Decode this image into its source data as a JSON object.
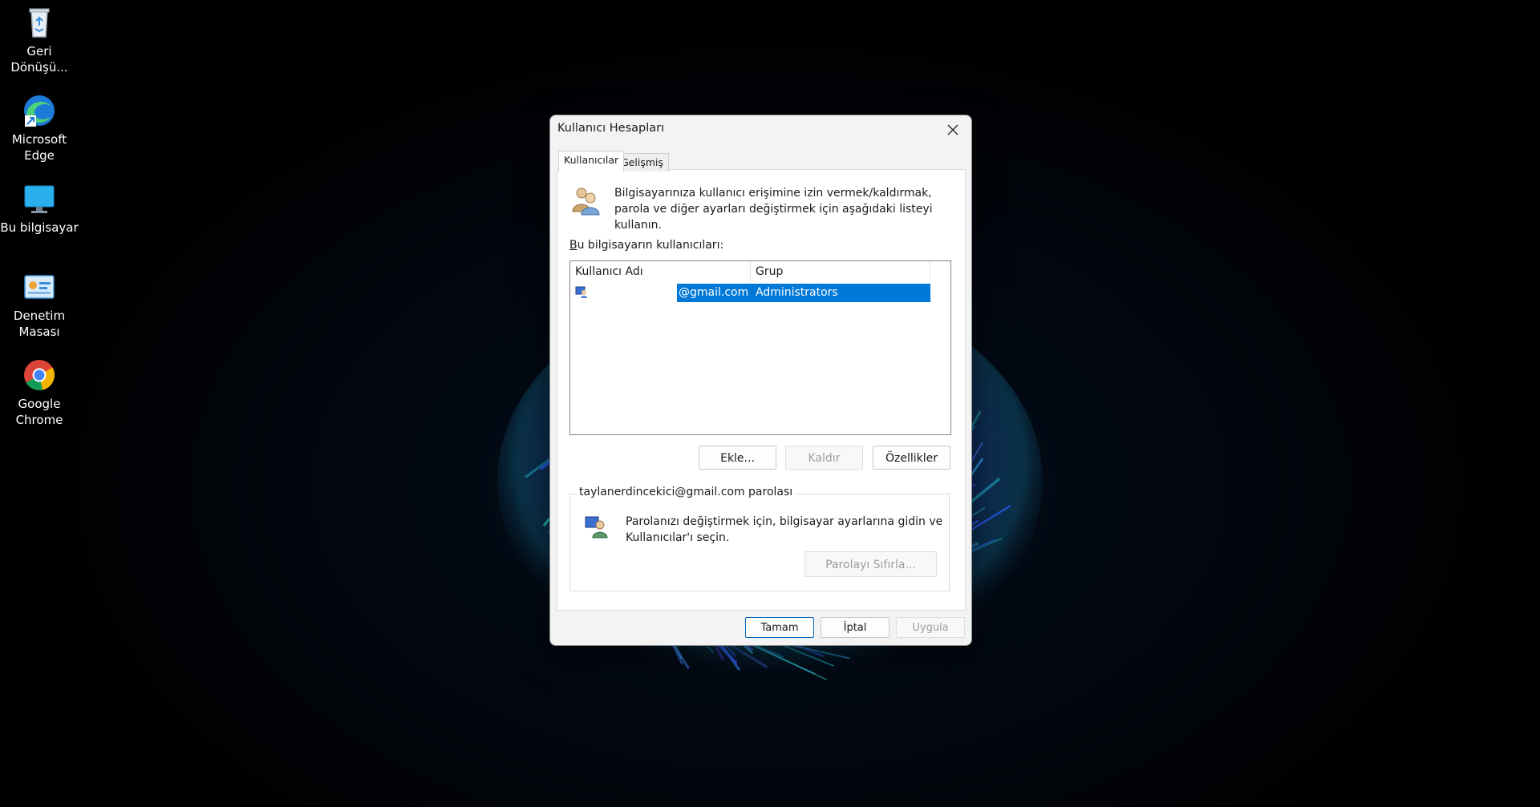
{
  "desktop": {
    "icons": [
      {
        "label": "Geri\nDönüşü...",
        "name": "recycle-bin"
      },
      {
        "label": "Microsoft\nEdge",
        "name": "microsoft-edge"
      },
      {
        "label": "Bu bilgisayar",
        "name": "this-pc"
      },
      {
        "label": "Denetim\nMasası",
        "name": "control-panel"
      },
      {
        "label": "Google\nChrome",
        "name": "google-chrome"
      }
    ]
  },
  "dialog": {
    "title": "Kullanıcı Hesapları",
    "tabs": [
      {
        "label": "Kullanıcılar"
      },
      {
        "label": "Gelişmiş"
      }
    ],
    "intro_text": "Bilgisayarınıza kullanıcı erişimine izin vermek/kaldırmak, parola ve diğer ayarları değiştirmek için aşağıdaki listeyi kullanın.",
    "users_label_prefix": "B",
    "users_label_rest": "u bilgisayarın kullanıcıları:",
    "list": {
      "columns": [
        "Kullanıcı Adı",
        "Grup"
      ],
      "rows": [
        {
          "user": "@gmail.com",
          "group": "Administrators"
        }
      ]
    },
    "buttons": {
      "add": "Ekle...",
      "remove": "Kaldır",
      "properties": "Özellikler"
    },
    "password_group": {
      "title": "taylanerdincekici@gmail.com parolası",
      "text": "Parolanızı değiştirmek için, bilgisayar ayarlarına gidin ve Kullanıcılar'ı seçin.",
      "reset_button": "Parolayı Sıfırla..."
    },
    "footer": {
      "ok": "Tamam",
      "cancel": "İptal",
      "apply": "Uygula"
    }
  },
  "colors": {
    "accent": "#0078d7",
    "desktop_bg": "#000000"
  }
}
